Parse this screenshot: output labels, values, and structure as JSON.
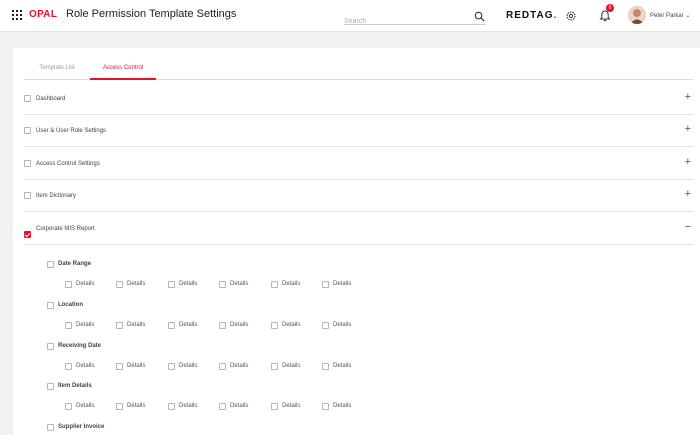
{
  "header": {
    "brand": "OPAL",
    "page_title": "Role Permission Template Settings",
    "search_placeholder": "Search",
    "logo_text": "REDTAG",
    "logo_dot": ".",
    "notification_count": "0",
    "user_name": "Peter Parkar",
    "icons": [
      "grid-icon",
      "search-icon",
      "gear-icon",
      "bell-icon",
      "chevron-down-icon"
    ]
  },
  "tabs": [
    {
      "label": "Template List",
      "active": false
    },
    {
      "label": "Access Control",
      "active": true
    }
  ],
  "accordion": [
    {
      "label": "Dashboard",
      "checked": false,
      "toggle": "+"
    },
    {
      "label": "User & User Role Settings",
      "checked": false,
      "toggle": "+"
    },
    {
      "label": "Access Control Settings",
      "checked": false,
      "toggle": "+"
    },
    {
      "label": "Item Dictionary",
      "checked": false,
      "toggle": "+"
    },
    {
      "label": "Corporate MIS Report",
      "checked": true,
      "toggle": "−"
    }
  ],
  "mis_sections": [
    {
      "label": "Date Range",
      "details": [
        "Details",
        "Details",
        "Details",
        "Details",
        "Details",
        "Details"
      ]
    },
    {
      "label": "Location",
      "details": [
        "Details",
        "Details",
        "Details",
        "Details",
        "Details",
        "Details"
      ]
    },
    {
      "label": "Receiving Date",
      "details": [
        "Details",
        "Details",
        "Details",
        "Details",
        "Details",
        "Details"
      ]
    },
    {
      "label": "Item Details",
      "details": [
        "Details",
        "Details",
        "Details",
        "Details",
        "Details",
        "Details"
      ]
    },
    {
      "label": "Supplier Invoice",
      "details": []
    }
  ],
  "colors": {
    "accent": "#e8102f",
    "text": "#333333",
    "border": "#e4e4e4",
    "background": "#f0f0f0"
  }
}
